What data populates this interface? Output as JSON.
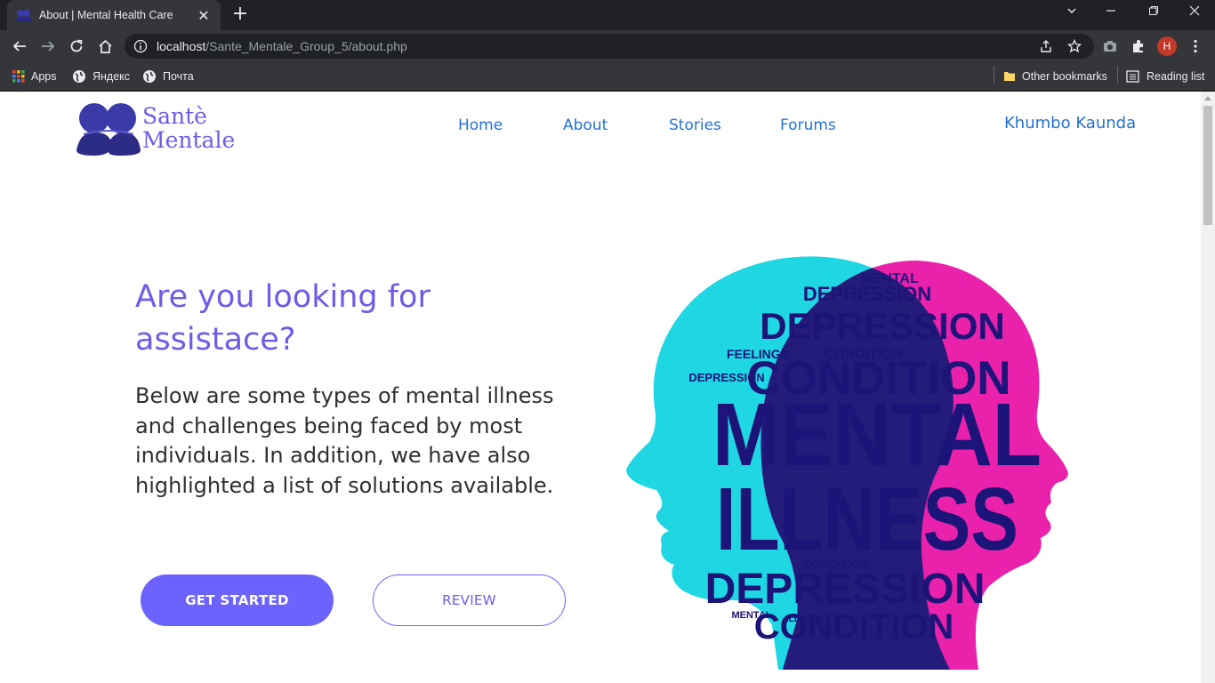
{
  "browser": {
    "tab_title": "About | Mental Health Care",
    "url_host": "localhost",
    "url_path": "/Sante_Mentale_Group_5/about.php",
    "profile_initial": "H",
    "bookmarks": {
      "apps": "Apps",
      "yandex": "Яндекс",
      "pochta": "Почта",
      "other": "Other bookmarks",
      "reading": "Reading list"
    }
  },
  "site": {
    "logo_line1": "Santè",
    "logo_line2": "Mentale",
    "brand_color": "#6c5ce7",
    "link_color": "#2471d6",
    "nav": [
      "Home",
      "About",
      "Stories",
      "Forums"
    ],
    "user_name": "Khumbo Kaunda"
  },
  "hero": {
    "title": "Are you looking for assistace?",
    "text": "Below are some types of mental illness and challenges being faced by most individuals. In addition, we have also highlighted a list of solutions available.",
    "primary_button": "GET STARTED",
    "secondary_button": "REVIEW"
  },
  "illustration": {
    "words": [
      "MENTAL",
      "ILLNESS",
      "DEPRESSION",
      "CONDITION",
      "FEELINGS"
    ],
    "colors": {
      "cyan": "#1fd6e3",
      "magenta": "#e81aa8",
      "navy": "#1c1478"
    }
  }
}
